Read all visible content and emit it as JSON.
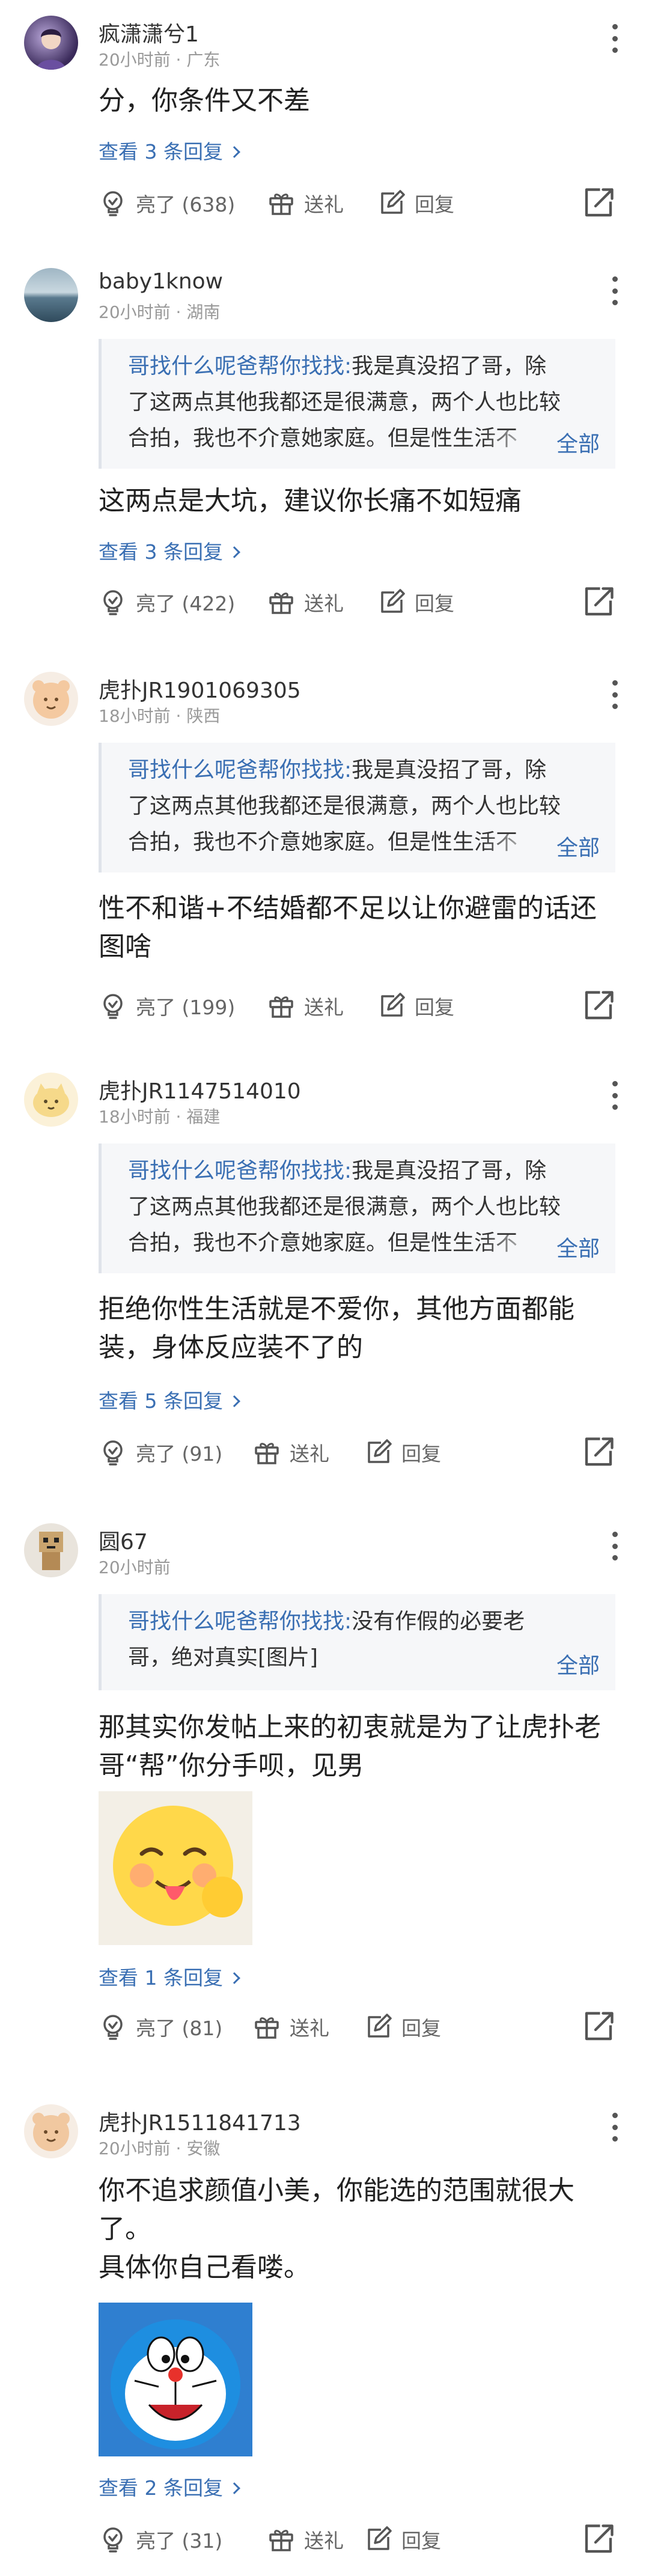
{
  "comments": [
    {
      "username": "疯潇潇兮1",
      "meta": "20小时前 · 广东",
      "text_lines": [
        "分，你条件又不差"
      ],
      "replies": "查看 3 条回复",
      "likes": "亮了 (638)",
      "gift": "送礼",
      "reply": "回复"
    },
    {
      "username": "baby1know",
      "meta": "20小时前 · 湖南",
      "quote_name": "哥找什么呢爸帮你找找:",
      "quote_lines": [
        "我是真没招了哥，除",
        "了这两点其他我都还是很满意，两个人也比较",
        "合拍，我也不介意她家庭。但是性生活不"
      ],
      "quote_all": "全部",
      "text_lines": [
        "这两点是大坑，建议你长痛不如短痛"
      ],
      "replies": "查看 3 条回复",
      "likes": "亮了 (422)",
      "gift": "送礼",
      "reply": "回复"
    },
    {
      "username": "虎扑JR1901069305",
      "meta": "18小时前 · 陕西",
      "quote_name": "哥找什么呢爸帮你找找:",
      "quote_lines": [
        "我是真没招了哥，除",
        "了这两点其他我都还是很满意，两个人也比较",
        "合拍，我也不介意她家庭。但是性生活不"
      ],
      "quote_all": "全部",
      "text_lines": [
        "性不和谐+不结婚都不足以让你避雷的话还",
        "图啥"
      ],
      "likes": "亮了 (199)",
      "gift": "送礼",
      "reply": "回复"
    },
    {
      "username": "虎扑JR1147514010",
      "meta": "18小时前 · 福建",
      "quote_name": "哥找什么呢爸帮你找找:",
      "quote_lines": [
        "我是真没招了哥，除",
        "了这两点其他我都还是很满意，两个人也比较",
        "合拍，我也不介意她家庭。但是性生活不"
      ],
      "quote_all": "全部",
      "text_lines": [
        "拒绝你性生活就是不爱你，其他方面都能",
        "装，身体反应装不了的"
      ],
      "replies": "查看 5 条回复",
      "likes": "亮了 (91)",
      "gift": "送礼",
      "reply": "回复"
    },
    {
      "username": "圆67",
      "meta": "20小时前",
      "quote_name": "哥找什么呢爸帮你找找:",
      "quote_lines": [
        "没有作假的必要老",
        "哥，绝对真实[图片]"
      ],
      "quote_all": "全部",
      "text_lines": [
        "那其实你发帖上来的初衷就是为了让虎扑老",
        "哥“帮”你分手呗，见男"
      ],
      "replies": "查看 1 条回复",
      "likes": "亮了 (81)",
      "gift": "送礼",
      "reply": "回复"
    },
    {
      "username": "虎扑JR1511841713",
      "meta": "20小时前 · 安徽",
      "text_lines": [
        "你不追求颜值小美，你能选的范围就很大",
        "了。",
        "具体你自己看喽。"
      ],
      "replies": "查看 2 条回复",
      "likes": "亮了 (31)",
      "gift": "送礼",
      "reply": "回复"
    }
  ],
  "colors": {
    "link": "#3a6fb3",
    "quote_bg": "#f6f7f9",
    "meta": "#999999",
    "action": "#666666"
  },
  "icons": [
    "more-vertical-icon",
    "lightbulb-icon",
    "gift-icon",
    "edit-icon",
    "share-icon",
    "chevron-right-icon"
  ]
}
